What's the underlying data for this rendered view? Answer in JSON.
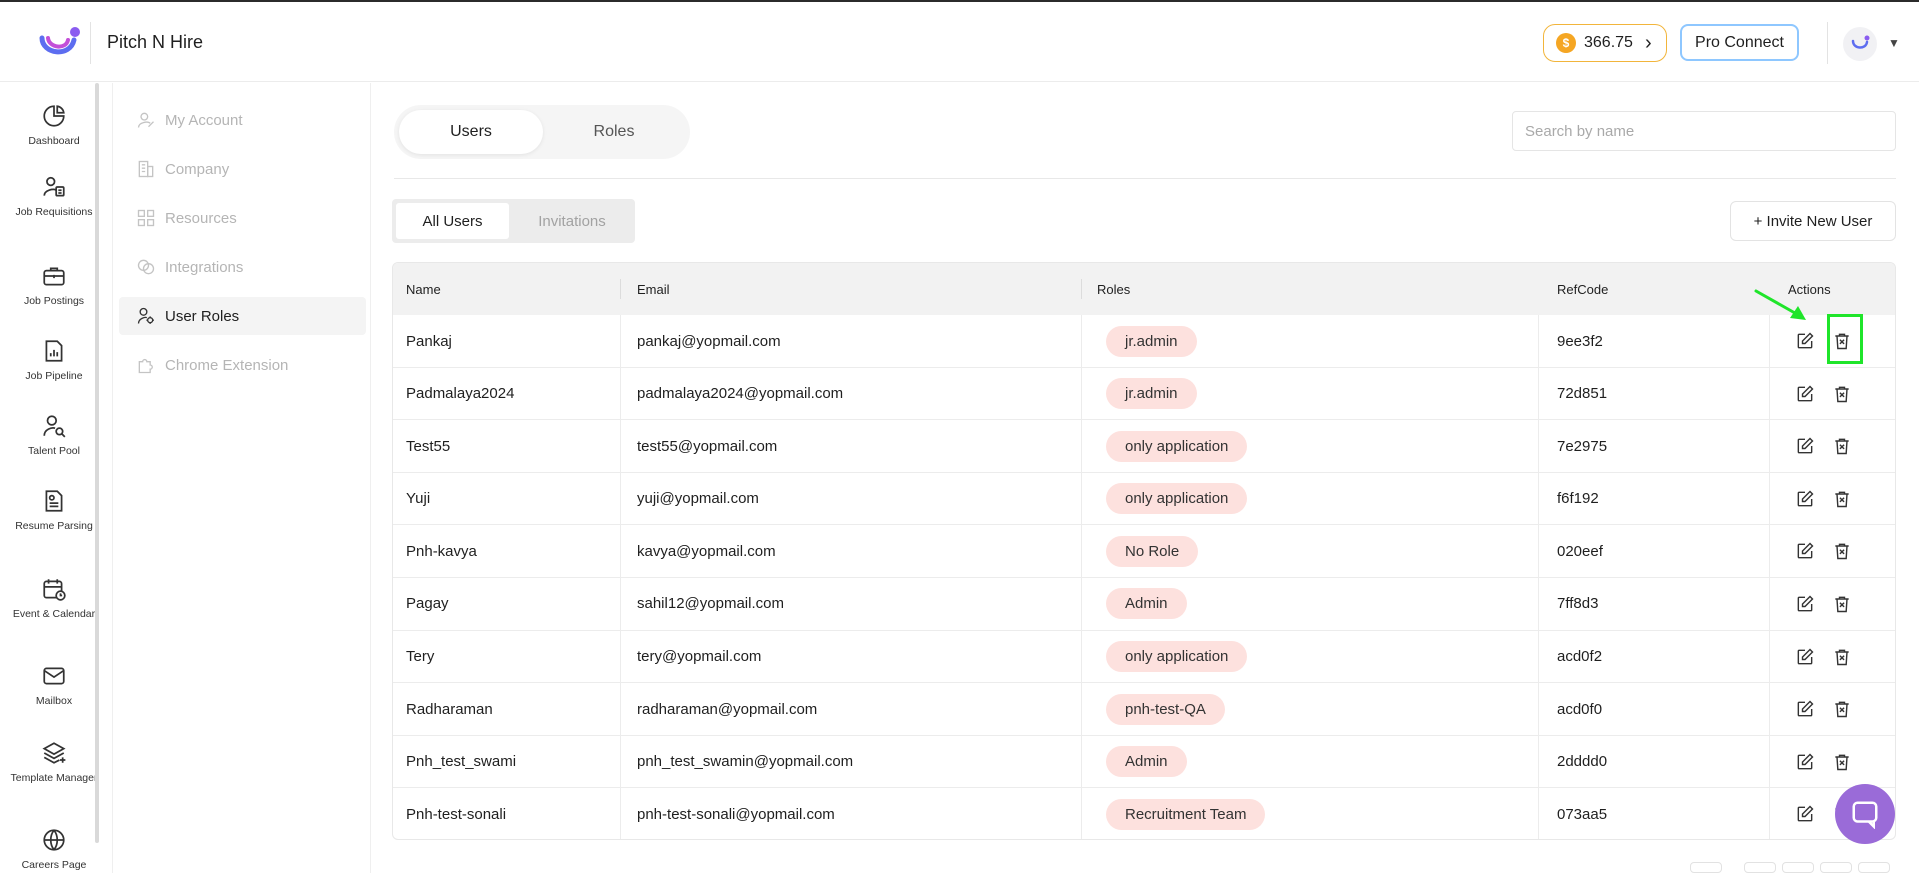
{
  "app": {
    "brand": "Pitch N Hire"
  },
  "header": {
    "coins": "366.75",
    "coin_symbol": "$",
    "pro_connect": "Pro Connect"
  },
  "rail": [
    {
      "label": "Dashboard",
      "icon": "pie-chart-icon"
    },
    {
      "label": "Job Requisitions",
      "icon": "user-document-icon"
    },
    {
      "label": "Job Postings",
      "icon": "briefcase-icon"
    },
    {
      "label": "Job Pipeline",
      "icon": "chart-document-icon"
    },
    {
      "label": "Talent Pool",
      "icon": "user-search-icon"
    },
    {
      "label": "Resume Parsing",
      "icon": "resume-icon"
    },
    {
      "label": "Event & Calendar",
      "icon": "calendar-icon"
    },
    {
      "label": "Mailbox",
      "icon": "mail-icon"
    },
    {
      "label": "Template Manager",
      "icon": "layers-icon"
    },
    {
      "label": "Careers Page",
      "icon": "globe-icon"
    }
  ],
  "subnav": [
    {
      "label": "My Account",
      "icon": "user-icon"
    },
    {
      "label": "Company",
      "icon": "building-icon"
    },
    {
      "label": "Resources",
      "icon": "grid-icon"
    },
    {
      "label": "Integrations",
      "icon": "link-icon"
    },
    {
      "label": "User Roles",
      "icon": "user-gear-icon"
    },
    {
      "label": "Chrome Extension",
      "icon": "puzzle-icon"
    }
  ],
  "tabs": {
    "users": "Users",
    "roles": "Roles"
  },
  "search": {
    "placeholder": "Search by name"
  },
  "subtabs": {
    "all_users": "All Users",
    "invitations": "Invitations"
  },
  "invite_button": "+ Invite New User",
  "table": {
    "headers": {
      "name": "Name",
      "email": "Email",
      "roles": "Roles",
      "refcode": "RefCode",
      "actions": "Actions"
    },
    "rows": [
      {
        "name": "Pankaj",
        "email": "pankaj@yopmail.com",
        "role": "jr.admin",
        "refcode": "9ee3f2"
      },
      {
        "name": "Padmalaya2024",
        "email": "padmalaya2024@yopmail.com",
        "role": "jr.admin",
        "refcode": "72d851"
      },
      {
        "name": "Test55",
        "email": "test55@yopmail.com",
        "role": "only application",
        "refcode": "7e2975"
      },
      {
        "name": "Yuji",
        "email": "yuji@yopmail.com",
        "role": "only application",
        "refcode": "f6f192"
      },
      {
        "name": "Pnh-kavya",
        "email": "kavya@yopmail.com",
        "role": "No Role",
        "refcode": "020eef"
      },
      {
        "name": "Pagay",
        "email": "sahil12@yopmail.com",
        "role": "Admin",
        "refcode": "7ff8d3"
      },
      {
        "name": "Tery",
        "email": "tery@yopmail.com",
        "role": "only application",
        "refcode": "acd0f2"
      },
      {
        "name": "Radharaman",
        "email": "radharaman@yopmail.com",
        "role": "pnh-test-QA",
        "refcode": "acd0f0"
      },
      {
        "name": "Pnh_test_swami",
        "email": "pnh_test_swamin@yopmail.com",
        "role": "Admin",
        "refcode": "2dddd0"
      },
      {
        "name": "Pnh-test-sonali",
        "email": "pnh-test-sonali@yopmail.com",
        "role": "Recruitment Team",
        "refcode": "073aa5"
      }
    ]
  },
  "colors": {
    "highlight": "#1fe52a",
    "role_pill": "#fde1de",
    "coin": "#f5a623",
    "chat": "#9a6bd8",
    "pro_border": "#8ec7ff"
  }
}
